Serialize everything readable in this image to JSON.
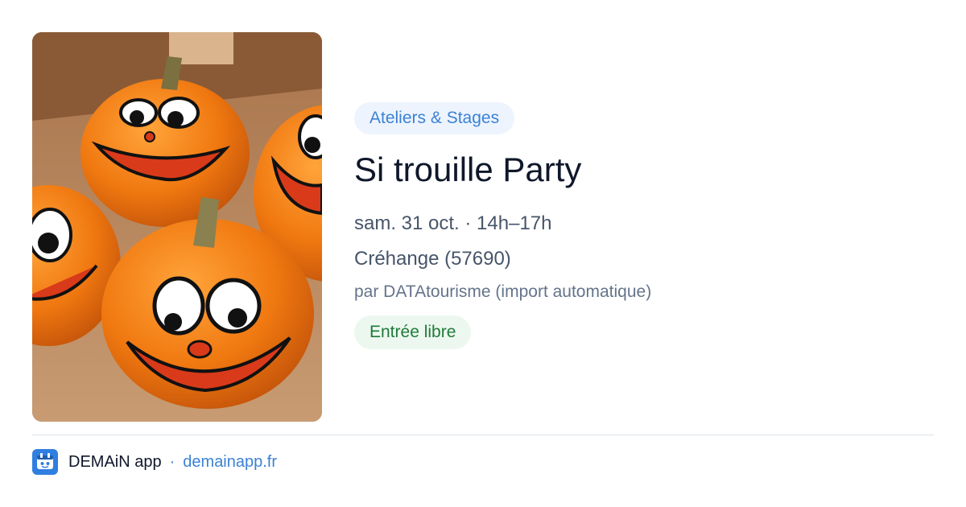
{
  "event": {
    "category": "Ateliers & Stages",
    "title": "Si trouille Party",
    "datetime": "sam. 31 oct. · 14h–17h",
    "location": "Créhange (57690)",
    "author": "par DATAtourisme (import automatique)",
    "price": "Entrée libre",
    "image_icon": "halloween-pumpkins-photo"
  },
  "footer": {
    "app_name": "DEMAiN app",
    "separator": "·",
    "link": "demainapp.fr",
    "logo_icon": "demain-app-logo-icon"
  },
  "colors": {
    "accent": "#3b82d6",
    "badge_bg": "#eef4fd",
    "price_text": "#1f7a3a",
    "price_bg": "#ecf8ef",
    "title": "#0f172a",
    "muted": "#475569"
  }
}
